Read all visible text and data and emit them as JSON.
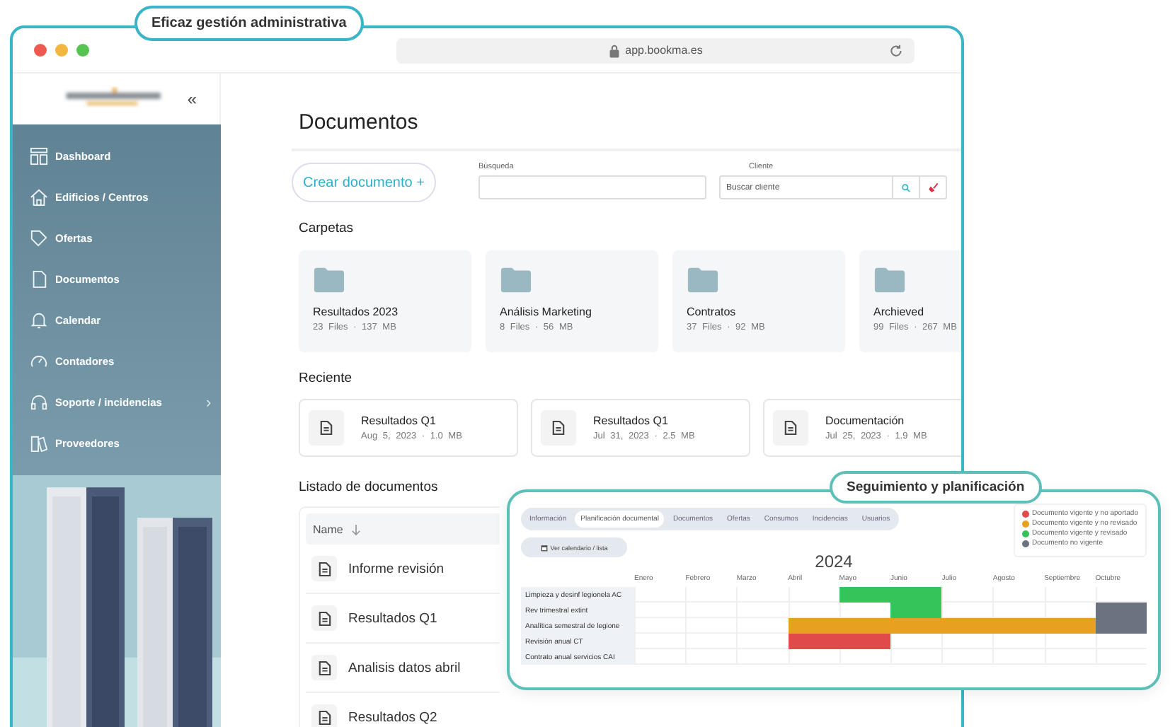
{
  "badge": "Eficaz gestión administrativa",
  "browser": {
    "url": "app.bookma.es"
  },
  "sidebar": {
    "collapse": "«",
    "items": [
      {
        "label": "Dashboard"
      },
      {
        "label": "Edificios / Centros"
      },
      {
        "label": "Ofertas"
      },
      {
        "label": "Documentos"
      },
      {
        "label": "Calendar"
      },
      {
        "label": "Contadores"
      },
      {
        "label": "Soporte / incidencias",
        "chevron": "›"
      },
      {
        "label": "Proveedores"
      }
    ]
  },
  "page": {
    "title": "Documentos",
    "create_button": "Crear documento +",
    "search": {
      "label": "Búsqueda"
    },
    "client": {
      "label": "Cliente",
      "placeholder": "Buscar cliente"
    },
    "folders_title": "Carpetas",
    "folders": [
      {
        "name": "Resultados 2023",
        "meta": "23 Files · 137 MB"
      },
      {
        "name": "Análisis Marketing",
        "meta": "8 Files · 56 MB"
      },
      {
        "name": "Contratos",
        "meta": "37 Files · 92 MB"
      },
      {
        "name": "Archieved",
        "meta": "99 Files · 267 MB"
      }
    ],
    "recent_title": "Reciente",
    "recent": [
      {
        "name": "Resultados Q1",
        "meta": "Aug 5, 2023 · 1.0 MB"
      },
      {
        "name": "Resultados Q1",
        "meta": "Jul 31, 2023 · 2.5 MB"
      },
      {
        "name": "Documentación",
        "meta": "Jul 25, 2023 · 1.9 MB"
      }
    ],
    "list_title": "Listado de documentos",
    "table": {
      "columns": [
        "Name"
      ],
      "rows": [
        "Informe revisión",
        "Resultados Q1",
        "Analisis datos abril",
        "Resultados Q2"
      ]
    }
  },
  "planning": {
    "badge": "Seguimiento y planificación",
    "tabs": [
      {
        "label": "Información",
        "selected": false
      },
      {
        "label": "Planificación documental",
        "selected": true
      },
      {
        "label": "Documentos",
        "selected": false
      },
      {
        "label": "Ofertas",
        "selected": false
      },
      {
        "label": "Consumos",
        "selected": false
      },
      {
        "label": "Incidencias",
        "selected": false
      },
      {
        "label": "Usuarios",
        "selected": false
      }
    ],
    "view_button": "Ver calendario / lista",
    "legend": [
      {
        "label": "Documento vigente y no aportado",
        "color": "#e04a4a"
      },
      {
        "label": "Documento vigente y no revisado",
        "color": "#e8a020"
      },
      {
        "label": "Documento vigente y revisado",
        "color": "#34c45a"
      },
      {
        "label": "Documento no vigente",
        "color": "#6b7280"
      }
    ],
    "year": "2024",
    "months": [
      "Enero",
      "Febrero",
      "Marzo",
      "Abril",
      "Mayo",
      "Junio",
      "Julio",
      "Agosto",
      "Septiembre",
      "Octubre"
    ],
    "rows": [
      {
        "label": "Limpieza y desinf legionela AC",
        "cells": [
          {
            "kind": "empty"
          },
          {
            "kind": "empty"
          },
          {
            "kind": "empty"
          },
          {
            "kind": "empty"
          },
          {
            "kind": "bar",
            "color": "#34c45a"
          },
          {
            "kind": "bar",
            "color": "#34c45a"
          },
          {
            "kind": "empty"
          },
          {
            "kind": "empty"
          },
          {
            "kind": "empty"
          },
          {
            "kind": "empty"
          }
        ]
      },
      {
        "label": "Rev trimestral extint",
        "cells": [
          {
            "kind": "empty"
          },
          {
            "kind": "empty"
          },
          {
            "kind": "empty"
          },
          {
            "kind": "empty"
          },
          {
            "kind": "empty"
          },
          {
            "kind": "bar",
            "color": "#34c45a"
          },
          {
            "kind": "empty"
          },
          {
            "kind": "empty"
          },
          {
            "kind": "empty"
          },
          {
            "kind": "bar",
            "color": "#6b7280"
          }
        ]
      },
      {
        "label": "Analítica semestral de legione",
        "cells": [
          {
            "kind": "empty"
          },
          {
            "kind": "empty"
          },
          {
            "kind": "empty"
          },
          {
            "kind": "bar",
            "color": "#e8a020"
          },
          {
            "kind": "bar",
            "color": "#e8a020"
          },
          {
            "kind": "bar",
            "color": "#e8a020"
          },
          {
            "kind": "bar",
            "color": "#e8a020"
          },
          {
            "kind": "bar",
            "color": "#e8a020"
          },
          {
            "kind": "bar",
            "color": "#e8a020"
          },
          {
            "kind": "bar",
            "color": "#6b7280"
          }
        ]
      },
      {
        "label": "Revisión anual CT",
        "cells": [
          {
            "kind": "empty"
          },
          {
            "kind": "empty"
          },
          {
            "kind": "empty"
          },
          {
            "kind": "bar",
            "color": "#e04a4a"
          },
          {
            "kind": "bar",
            "color": "#e04a4a"
          },
          {
            "kind": "empty"
          },
          {
            "kind": "empty"
          },
          {
            "kind": "empty"
          },
          {
            "kind": "empty"
          },
          {
            "kind": "empty"
          }
        ]
      },
      {
        "label": "Contrato anual servicios CAI",
        "cells": [
          {
            "kind": "empty"
          },
          {
            "kind": "empty"
          },
          {
            "kind": "empty"
          },
          {
            "kind": "empty"
          },
          {
            "kind": "empty"
          },
          {
            "kind": "empty"
          },
          {
            "kind": "empty"
          },
          {
            "kind": "empty"
          },
          {
            "kind": "empty"
          },
          {
            "kind": "empty"
          }
        ]
      }
    ]
  }
}
